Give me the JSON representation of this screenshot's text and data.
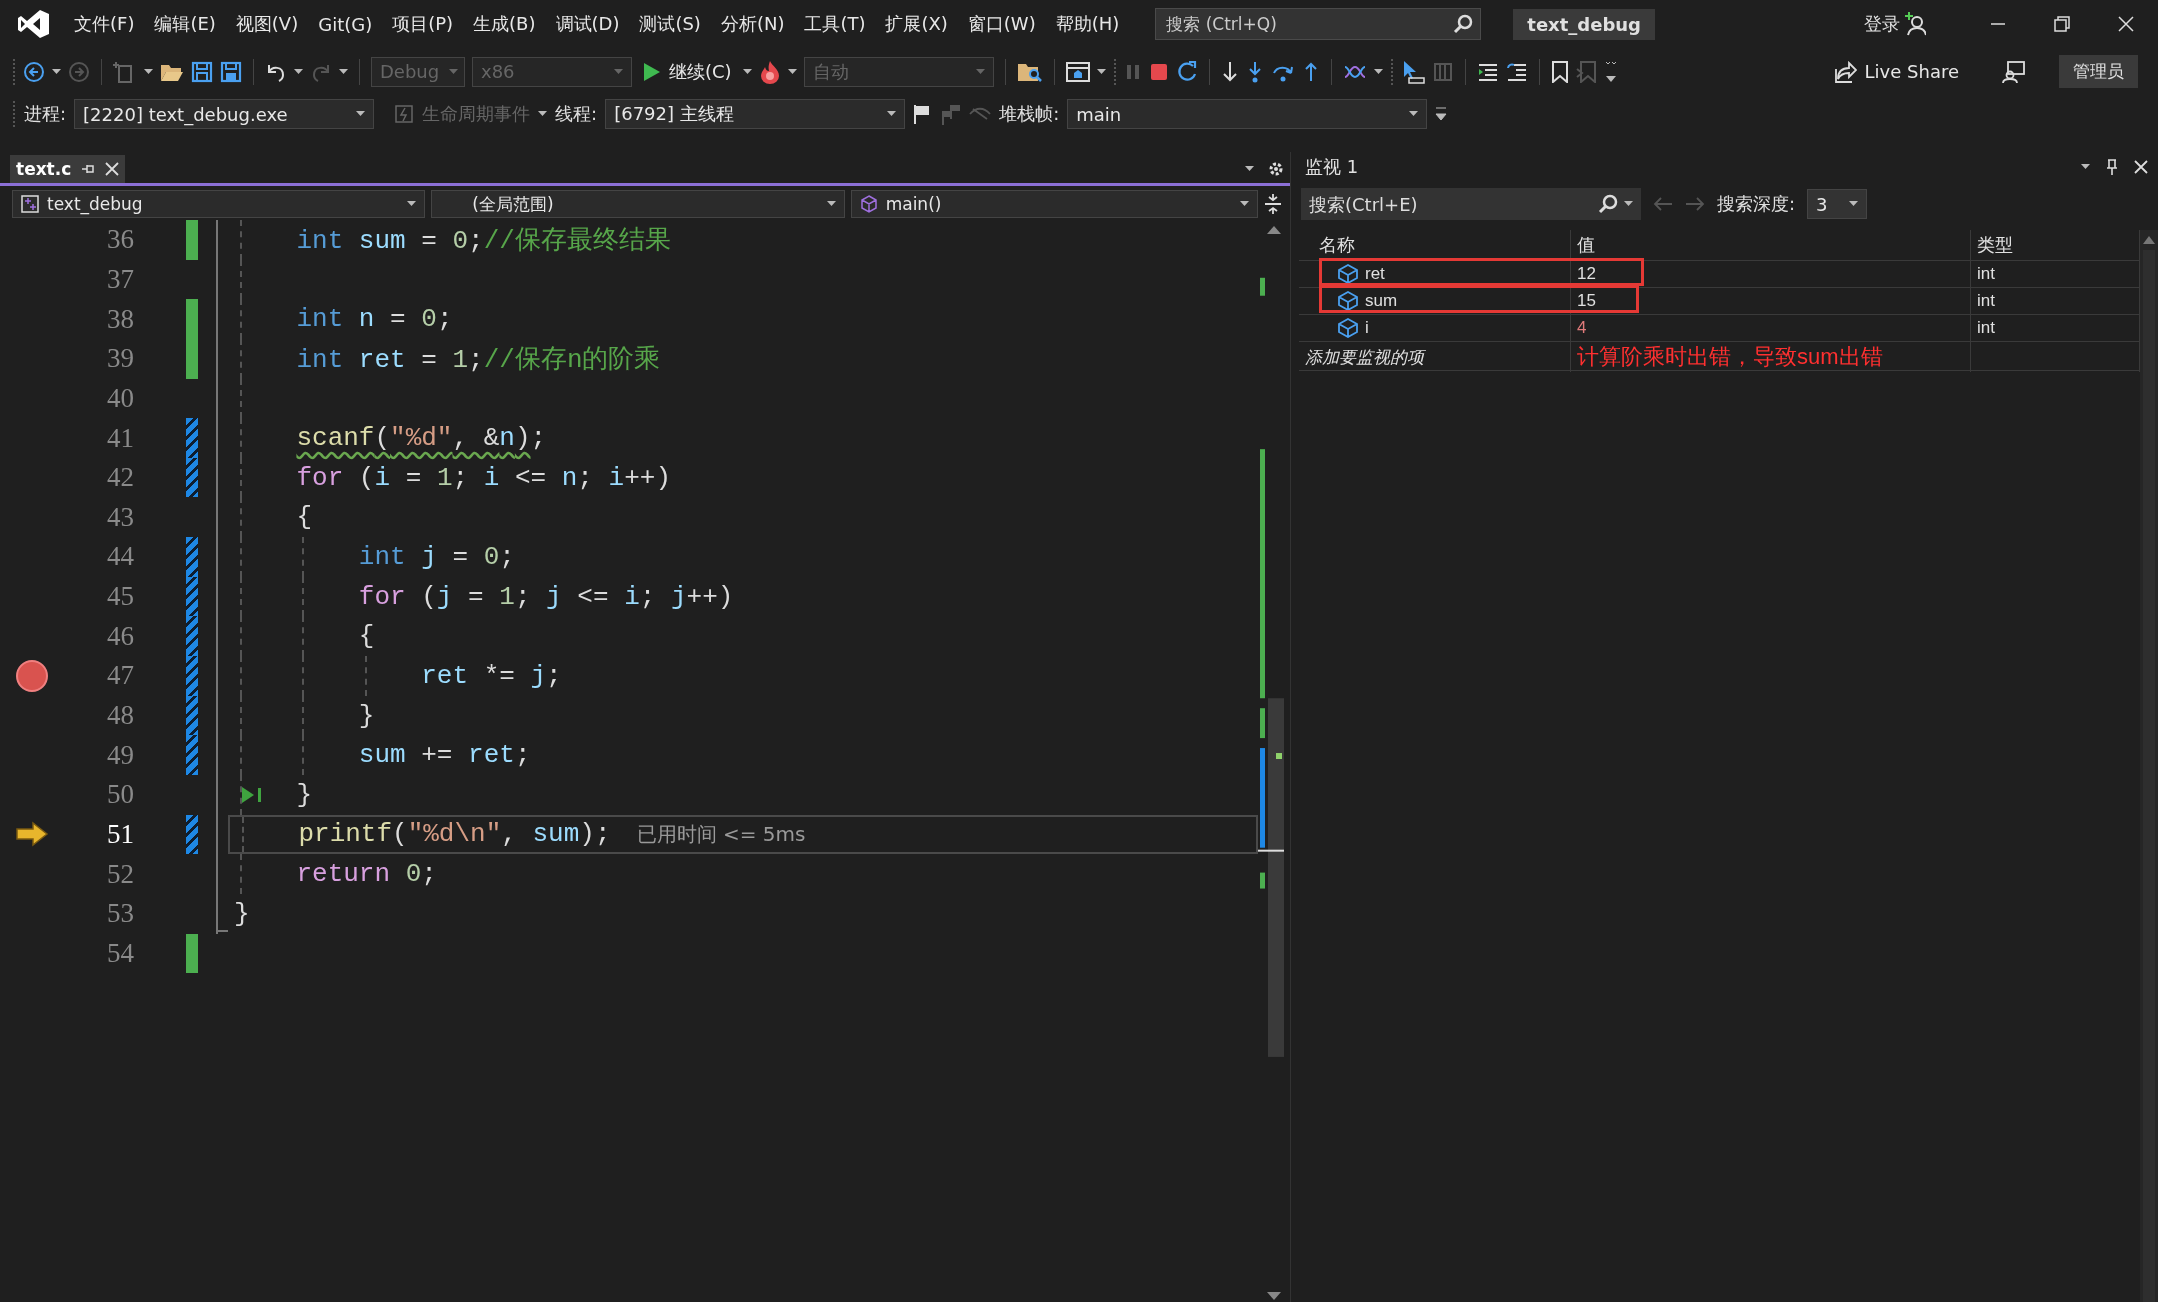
{
  "menu": [
    "文件(F)",
    "编辑(E)",
    "视图(V)",
    "Git(G)",
    "项目(P)",
    "生成(B)",
    "调试(D)",
    "测试(S)",
    "分析(N)",
    "工具(T)",
    "扩展(X)",
    "窗口(W)",
    "帮助(H)"
  ],
  "search": {
    "placeholder": "搜索 (Ctrl+Q)"
  },
  "solution_name": "text_debug",
  "sign_in": "登录",
  "toolbar": {
    "config_combo": {
      "value": "Debug",
      "disabled": true
    },
    "platform_combo": {
      "value": "x86",
      "disabled": true
    },
    "continue_button": {
      "label": "继续(C)"
    },
    "target_combo": {
      "value": "自动",
      "disabled": true
    },
    "live_share": {
      "label": "Live Share"
    },
    "admin_badge": "管理员"
  },
  "debug_location": {
    "process": {
      "label": "进程:",
      "value": "[2220] text_debug.exe",
      "disabled": false
    },
    "lifecycle": {
      "label": "生命周期事件",
      "disabled": true
    },
    "thread": {
      "label": "线程:",
      "value": "[6792] 主线程",
      "disabled": false
    },
    "stack_frame": {
      "label": "堆栈帧:",
      "value": "main",
      "disabled": false
    }
  },
  "editor": {
    "tab": {
      "title": "text.c",
      "selected": true
    },
    "nav": {
      "project": "text_debug",
      "scope": "(全局范围)",
      "member": "main()"
    },
    "lines": [
      {
        "number": "36",
        "saved": true,
        "edited": false,
        "breakpoint": false,
        "current": false,
        "run_to_click": false,
        "tokens": [
          {
            "kind": "keyword",
            "text": "    int"
          },
          {
            "kind": "var",
            "text": " sum"
          },
          {
            "kind": "punct",
            "text": " = "
          },
          {
            "kind": "num",
            "text": "0"
          },
          {
            "kind": "punct",
            "text": ";"
          },
          {
            "kind": "comment",
            "text": "//保存最终结果"
          }
        ]
      },
      {
        "number": "37",
        "saved": false,
        "edited": false,
        "breakpoint": false,
        "current": false,
        "run_to_click": false
      },
      {
        "number": "38",
        "saved": true,
        "edited": false,
        "breakpoint": false,
        "current": false,
        "run_to_click": false,
        "tokens": [
          {
            "kind": "keyword",
            "text": "    int"
          },
          {
            "kind": "var",
            "text": " n"
          },
          {
            "kind": "punct",
            "text": " = "
          },
          {
            "kind": "num",
            "text": "0"
          },
          {
            "kind": "punct",
            "text": ";"
          }
        ]
      },
      {
        "number": "39",
        "saved": true,
        "edited": false,
        "breakpoint": false,
        "current": false,
        "run_to_click": false,
        "tokens": [
          {
            "kind": "keyword",
            "text": "    int"
          },
          {
            "kind": "var",
            "text": " ret"
          },
          {
            "kind": "punct",
            "text": " = "
          },
          {
            "kind": "num",
            "text": "1"
          },
          {
            "kind": "punct",
            "text": ";"
          },
          {
            "kind": "comment",
            "text": "//保存n的阶乘"
          }
        ]
      },
      {
        "number": "40",
        "saved": false,
        "edited": false,
        "breakpoint": false,
        "current": false,
        "run_to_click": false
      },
      {
        "number": "41",
        "saved": false,
        "edited": true,
        "breakpoint": false,
        "current": false,
        "run_to_click": false,
        "tokens": [
          {
            "kind": "warning",
            "children": [
              {
                "kind": "fn",
                "text": "    scanf"
              },
              {
                "kind": "punct",
                "text": "("
              },
              {
                "kind": "str",
                "text": "\"%d\""
              },
              {
                "kind": "punct",
                "text": ", &"
              },
              {
                "kind": "var",
                "text": "n"
              },
              {
                "kind": "punct",
                "text": ")"
              }
            ]
          },
          {
            "kind": "punct",
            "text": ";"
          }
        ]
      },
      {
        "number": "42",
        "saved": false,
        "edited": true,
        "breakpoint": false,
        "current": false,
        "run_to_click": false,
        "tokens": [
          {
            "kind": "control",
            "text": "    for"
          },
          {
            "kind": "punct",
            "text": " ("
          },
          {
            "kind": "var",
            "text": "i"
          },
          {
            "kind": "punct",
            "text": " = "
          },
          {
            "kind": "num",
            "text": "1"
          },
          {
            "kind": "punct",
            "text": "; "
          },
          {
            "kind": "var",
            "text": "i"
          },
          {
            "kind": "punct",
            "text": " <= "
          },
          {
            "kind": "var",
            "text": "n"
          },
          {
            "kind": "punct",
            "text": "; "
          },
          {
            "kind": "var",
            "text": "i"
          },
          {
            "kind": "punct",
            "text": "++)"
          }
        ]
      },
      {
        "number": "43",
        "saved": false,
        "edited": false,
        "breakpoint": false,
        "current": false,
        "run_to_click": false,
        "tokens": [
          {
            "kind": "punct",
            "text": "    {"
          }
        ]
      },
      {
        "number": "44",
        "saved": false,
        "edited": true,
        "breakpoint": false,
        "current": false,
        "run_to_click": false,
        "tokens": [
          {
            "kind": "keyword",
            "text": "        int"
          },
          {
            "kind": "var",
            "text": " j"
          },
          {
            "kind": "punct",
            "text": " = "
          },
          {
            "kind": "num",
            "text": "0"
          },
          {
            "kind": "punct",
            "text": ";"
          }
        ]
      },
      {
        "number": "45",
        "saved": false,
        "edited": true,
        "breakpoint": false,
        "current": false,
        "run_to_click": false,
        "tokens": [
          {
            "kind": "control",
            "text": "        for"
          },
          {
            "kind": "punct",
            "text": " ("
          },
          {
            "kind": "var",
            "text": "j"
          },
          {
            "kind": "punct",
            "text": " = "
          },
          {
            "kind": "num",
            "text": "1"
          },
          {
            "kind": "punct",
            "text": "; "
          },
          {
            "kind": "var",
            "text": "j"
          },
          {
            "kind": "punct",
            "text": " <= "
          },
          {
            "kind": "var",
            "text": "i"
          },
          {
            "kind": "punct",
            "text": "; "
          },
          {
            "kind": "var",
            "text": "j"
          },
          {
            "kind": "punct",
            "text": "++)"
          }
        ]
      },
      {
        "number": "46",
        "saved": false,
        "edited": true,
        "breakpoint": false,
        "current": false,
        "run_to_click": false,
        "tokens": [
          {
            "kind": "punct",
            "text": "        {"
          }
        ]
      },
      {
        "number": "47",
        "saved": false,
        "edited": true,
        "breakpoint": true,
        "current": false,
        "run_to_click": false,
        "tokens": [
          {
            "kind": "var",
            "text": "            ret"
          },
          {
            "kind": "punct",
            "text": " *= "
          },
          {
            "kind": "var",
            "text": "j"
          },
          {
            "kind": "punct",
            "text": ";"
          }
        ]
      },
      {
        "number": "48",
        "saved": false,
        "edited": true,
        "breakpoint": false,
        "current": false,
        "run_to_click": false,
        "tokens": [
          {
            "kind": "punct",
            "text": "        }"
          }
        ]
      },
      {
        "number": "49",
        "saved": false,
        "edited": true,
        "breakpoint": false,
        "current": false,
        "run_to_click": false,
        "tokens": [
          {
            "kind": "var",
            "text": "        sum"
          },
          {
            "kind": "punct",
            "text": " += "
          },
          {
            "kind": "var",
            "text": "ret"
          },
          {
            "kind": "punct",
            "text": ";"
          }
        ]
      },
      {
        "number": "50",
        "saved": false,
        "edited": false,
        "breakpoint": false,
        "current": false,
        "run_to_click": true,
        "tokens": [
          {
            "kind": "punct",
            "text": "    }"
          }
        ]
      },
      {
        "number": "51",
        "saved": false,
        "edited": true,
        "breakpoint": false,
        "current": true,
        "run_to_click": false,
        "perf_tip": "已用时间 <= 5ms",
        "tokens": [
          {
            "kind": "fn",
            "text": "    printf"
          },
          {
            "kind": "punct",
            "text": "("
          },
          {
            "kind": "str",
            "text": "\"%d\\n\""
          },
          {
            "kind": "punct",
            "text": ", "
          },
          {
            "kind": "var",
            "text": "sum"
          },
          {
            "kind": "punct",
            "text": ");"
          }
        ]
      },
      {
        "number": "52",
        "saved": false,
        "edited": false,
        "breakpoint": false,
        "current": false,
        "run_to_click": false,
        "tokens": [
          {
            "kind": "control",
            "text": "    return"
          },
          {
            "kind": "num",
            "text": " 0"
          },
          {
            "kind": "punct",
            "text": ";"
          }
        ]
      },
      {
        "number": "53",
        "saved": false,
        "edited": false,
        "breakpoint": false,
        "current": false,
        "run_to_click": false,
        "tokens": [
          {
            "kind": "punct",
            "text": "}"
          }
        ]
      },
      {
        "number": "54",
        "saved": true,
        "edited": false,
        "breakpoint": false,
        "current": false,
        "run_to_click": false
      }
    ]
  },
  "watch": {
    "title": "监视 1",
    "search": {
      "placeholder": "搜索(Ctrl+E)"
    },
    "depth_label": "搜索深度:",
    "depth_value": "3",
    "columns": [
      "名称",
      "值",
      "类型"
    ],
    "rows": [
      {
        "name": "ret",
        "value": "12",
        "type": "int",
        "changed": false,
        "highlighted": true
      },
      {
        "name": "sum",
        "value": "15",
        "type": "int",
        "changed": false,
        "highlighted": true
      },
      {
        "name": "i",
        "value": "4",
        "type": "int",
        "changed": true,
        "highlighted": false
      }
    ],
    "add_placeholder": "添加要监视的项",
    "annotation": "计算阶乘时出错，导致sum出错"
  }
}
